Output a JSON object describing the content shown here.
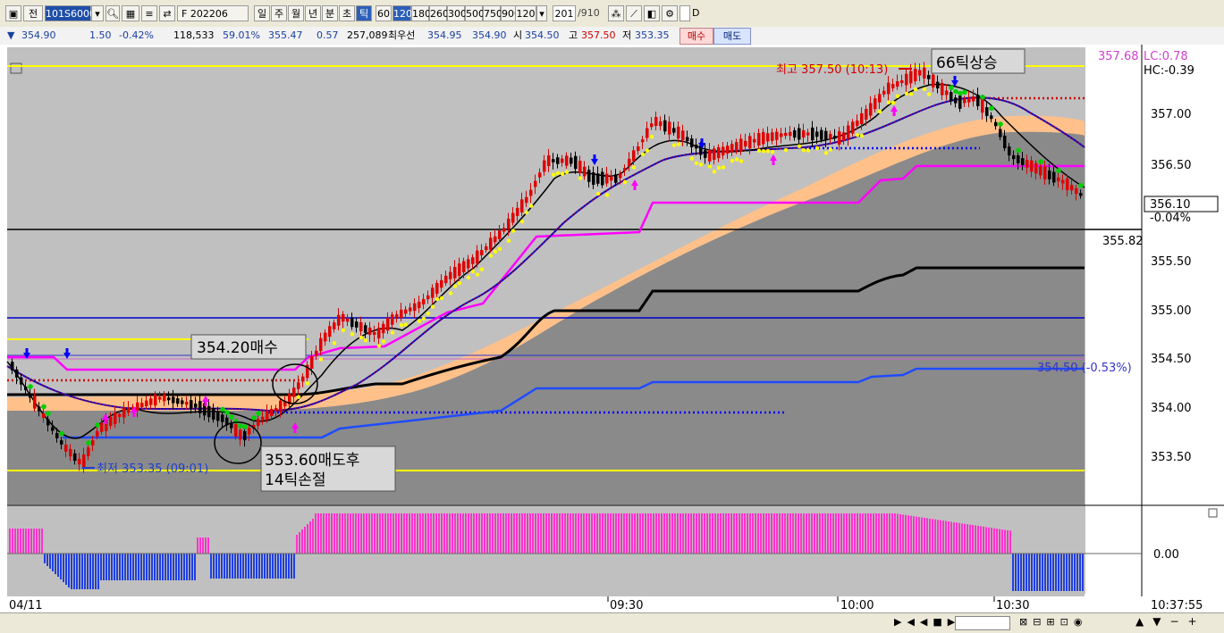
{
  "toolbar": {
    "label_jeon": "전",
    "code": "101S6000",
    "name": "F 202206",
    "periods": [
      "일",
      "주",
      "월",
      "년",
      "분",
      "초",
      "틱"
    ],
    "tick_nums": [
      "60",
      "120",
      "180",
      "260",
      "300",
      "500",
      "750",
      "900"
    ],
    "tick_value": "120",
    "count": "201",
    "total": "/910",
    "checkbox_label": "D"
  },
  "quote": {
    "price": "354.90",
    "change": "1.50",
    "pct": "-0.42%",
    "volume": "118,533",
    "ratio": "59.01%",
    "v1": "355.47",
    "v2": "0.57",
    "v3": "257,089",
    "priority_label": "최우선",
    "bid": "354.95",
    "ask": "354.90",
    "open_label": "시",
    "open": "354.50",
    "high_label": "고",
    "high": "357.50",
    "low_label": "저",
    "low": "353.35",
    "buy": "매수",
    "sell": "매도"
  },
  "chart": {
    "price_ticks": [
      "357.00",
      "356.50",
      "356.00",
      "355.50",
      "355.00",
      "354.50",
      "354.00",
      "353.50"
    ],
    "last_price": "356.10",
    "last_pct": "-0.04%",
    "ref_line": "355.82",
    "top_right_price": "357.68",
    "lc_label": "LC:0.78",
    "hc_label": "HC:-0.39",
    "open_label": "354.50 (-0.53%)",
    "low_note": "최저 353.35 (09:01)",
    "high_note": "최고 357.50 (10:13)",
    "box_buy": "354.20매수",
    "box_sell_1": "353.60매도후",
    "box_sell_2": "14틱손절",
    "box_rise": "66틱상승",
    "osc_zero": "0.00",
    "time_labels": [
      "04/11",
      "09:30",
      "10:00",
      "10:30"
    ],
    "clock": "10:37:55"
  },
  "colors": {
    "up": "#d80000",
    "down": "#000000",
    "yellow": "#ffff00",
    "magenta": "#ff00ff",
    "blue": "#0000ff",
    "cloud": "#ffc08a",
    "gray_area": "#8a8a8a"
  }
}
